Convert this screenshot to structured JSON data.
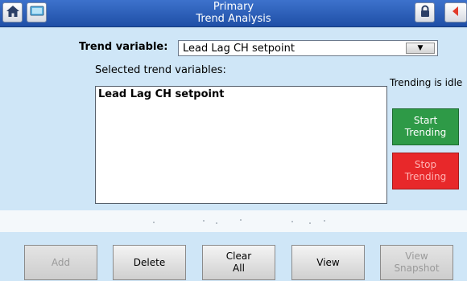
{
  "header": {
    "title_line1": "Primary",
    "title_line2": "Trend Analysis",
    "icons": [
      "home-icon",
      "monitor-icon",
      "lock-icon",
      "back-icon"
    ]
  },
  "trend": {
    "variable_label": "Trend variable:",
    "variable_value": "Lead Lag CH setpoint",
    "selected_label": "Selected trend variables:",
    "selected_items": [
      "Lead Lag CH setpoint"
    ]
  },
  "status": {
    "text": "Trending is idle"
  },
  "side_buttons": {
    "start": [
      "Start",
      "Trending"
    ],
    "stop": [
      "Stop",
      "Trending"
    ]
  },
  "bottom_buttons": {
    "add": "Add",
    "delete": "Delete",
    "clear": [
      "Clear",
      "All"
    ],
    "view": "View",
    "view_snapshot": [
      "View",
      "Snapshot"
    ]
  },
  "colors": {
    "background": "#cfe6f7",
    "titlebar": "#2a5fb8",
    "start": "#2e9a47",
    "stop": "#e8282a"
  }
}
